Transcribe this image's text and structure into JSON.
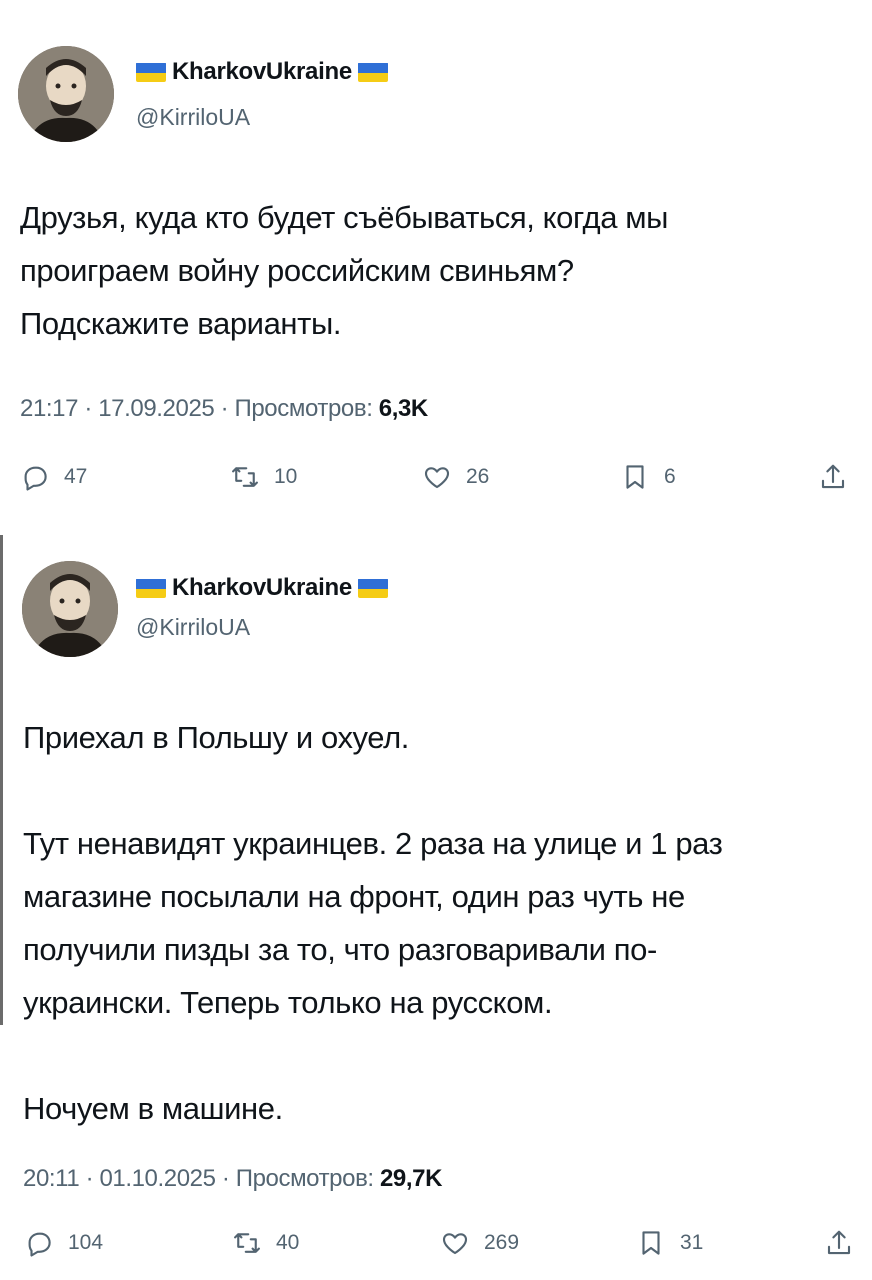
{
  "tweets": [
    {
      "author": {
        "display_name": "KharkovUkraine",
        "handle": "@KirriloUA",
        "flag_colors": [
          "#2f6fd6",
          "#f5cc15"
        ]
      },
      "text_lines": [
        "Друзья, куда кто будет съёбываться, когда мы",
        "проиграем войну российским свиньям?",
        "Подскажите варианты."
      ],
      "time": "21:17",
      "date": "17.09.2025",
      "views_label": "Просмотров:",
      "views": "6,3K",
      "actions": {
        "replies": "47",
        "retweets": "10",
        "likes": "26",
        "bookmarks": "6"
      }
    },
    {
      "author": {
        "display_name": "KharkovUkraine",
        "handle": "@KirriloUA",
        "flag_colors": [
          "#2f6fd6",
          "#f5cc15"
        ]
      },
      "text_lines": [
        "Приехал в Польшу и охуел.",
        "",
        "Тут ненавидят украинцев. 2 раза на улице и 1 раз",
        "магазине посылали на фронт, один раз чуть не",
        "получили пизды за то, что разговаривали по-",
        "украински. Теперь только на русском.",
        "",
        "Ночуем в машине."
      ],
      "time": "20:11",
      "date": "01.10.2025",
      "views_label": "Просмотров:",
      "views": "29,7K",
      "actions": {
        "replies": "104",
        "retweets": "40",
        "likes": "269",
        "bookmarks": "31"
      }
    }
  ],
  "icons": {
    "reply": "comment-icon",
    "retweet": "retweet-icon",
    "like": "heart-icon",
    "bookmark": "bookmark-icon",
    "share": "share-icon"
  },
  "colors": {
    "text": "#0f1419",
    "secondary": "#536471",
    "flag_blue": "#2f6fd6",
    "flag_yellow": "#f5cc15"
  }
}
